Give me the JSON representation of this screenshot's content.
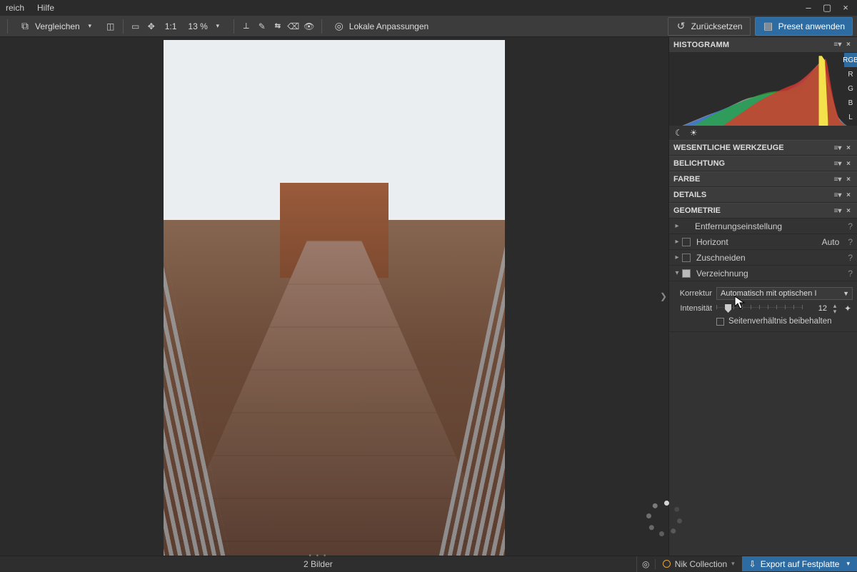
{
  "menu": {
    "items": [
      "reich",
      "Hilfe"
    ]
  },
  "window_controls": {
    "min": "–",
    "max": "▢",
    "close": "×"
  },
  "toolbar": {
    "compare_label": "Vergleichen",
    "zoom_label": "1:1",
    "zoom_pct": "13 %",
    "local_adjust_label": "Lokale Anpassungen",
    "reset_label": "Zurücksetzen",
    "preset_label": "Preset anwenden"
  },
  "histogram": {
    "title": "HISTOGRAMM",
    "channels": [
      "RGB",
      "R",
      "G",
      "B",
      "L"
    ],
    "active_channel": 0
  },
  "sections": {
    "essential": "WESENTLICHE WERKZEUGE",
    "exposure": "BELICHTUNG",
    "color": "FARBE",
    "detail": "DETAILS",
    "geometry": "GEOMETRIE"
  },
  "geometry": {
    "distance": "Entfernungseinstellung",
    "horizon": "Horizont",
    "horizon_auto": "Auto",
    "crop": "Zuschneiden",
    "distortion": "Verzeichnung",
    "correction_label": "Korrektur",
    "correction_value": "Automatisch mit optischen I",
    "intensity_label": "Intensität",
    "intensity_value": "12",
    "keep_aspect": "Seitenverhältnis beibehalten"
  },
  "status": {
    "count": "2 Bilder",
    "nik": "Nik Collection",
    "export": "Export auf Festplatte"
  },
  "help_glyph": "?",
  "menu_glyph": "≡▾",
  "close_glyph": "×"
}
